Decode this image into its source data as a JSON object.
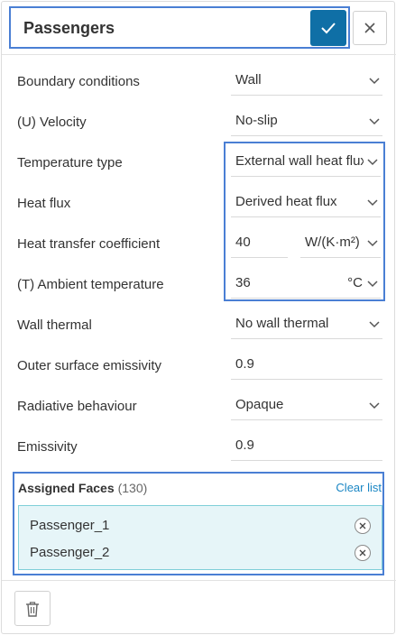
{
  "header": {
    "title": "Passengers"
  },
  "rows": [
    {
      "label": "Boundary conditions",
      "value": "Wall",
      "dropdown": true
    },
    {
      "label": "(U) Velocity",
      "value": "No-slip",
      "dropdown": true
    },
    {
      "label": "Temperature type",
      "value": "External wall heat flux",
      "dropdown": true
    },
    {
      "label": "Heat flux",
      "value": "Derived heat flux",
      "dropdown": true
    },
    {
      "label": "Heat transfer coefficient",
      "value": "40",
      "unit": "W/(K·m²)"
    },
    {
      "label": "(T) Ambient temperature",
      "value": "36",
      "unit": "°C"
    },
    {
      "label": "Wall thermal",
      "value": "No wall thermal",
      "dropdown": true
    },
    {
      "label": "Outer surface emissivity",
      "value": "0.9",
      "dropdown": false
    },
    {
      "label": "Radiative behaviour",
      "value": "Opaque",
      "dropdown": true
    },
    {
      "label": "Emissivity",
      "value": "0.9",
      "dropdown": false
    }
  ],
  "assigned_faces": {
    "title": "Assigned Faces",
    "count": "(130)",
    "clear_label": "Clear list",
    "items": [
      "Passenger_1",
      "Passenger_2"
    ]
  },
  "icons": {
    "confirm": "check-icon",
    "close": "close-icon",
    "dropdown": "chevron-down-icon",
    "remove": "remove-circle-icon",
    "delete": "trash-icon"
  },
  "colors": {
    "accent": "#0f6fa6",
    "highlight_border": "#4a7fd4",
    "link": "#1a86c4",
    "faces_bg": "#e6f5f8",
    "faces_border": "#7fcfd8"
  }
}
